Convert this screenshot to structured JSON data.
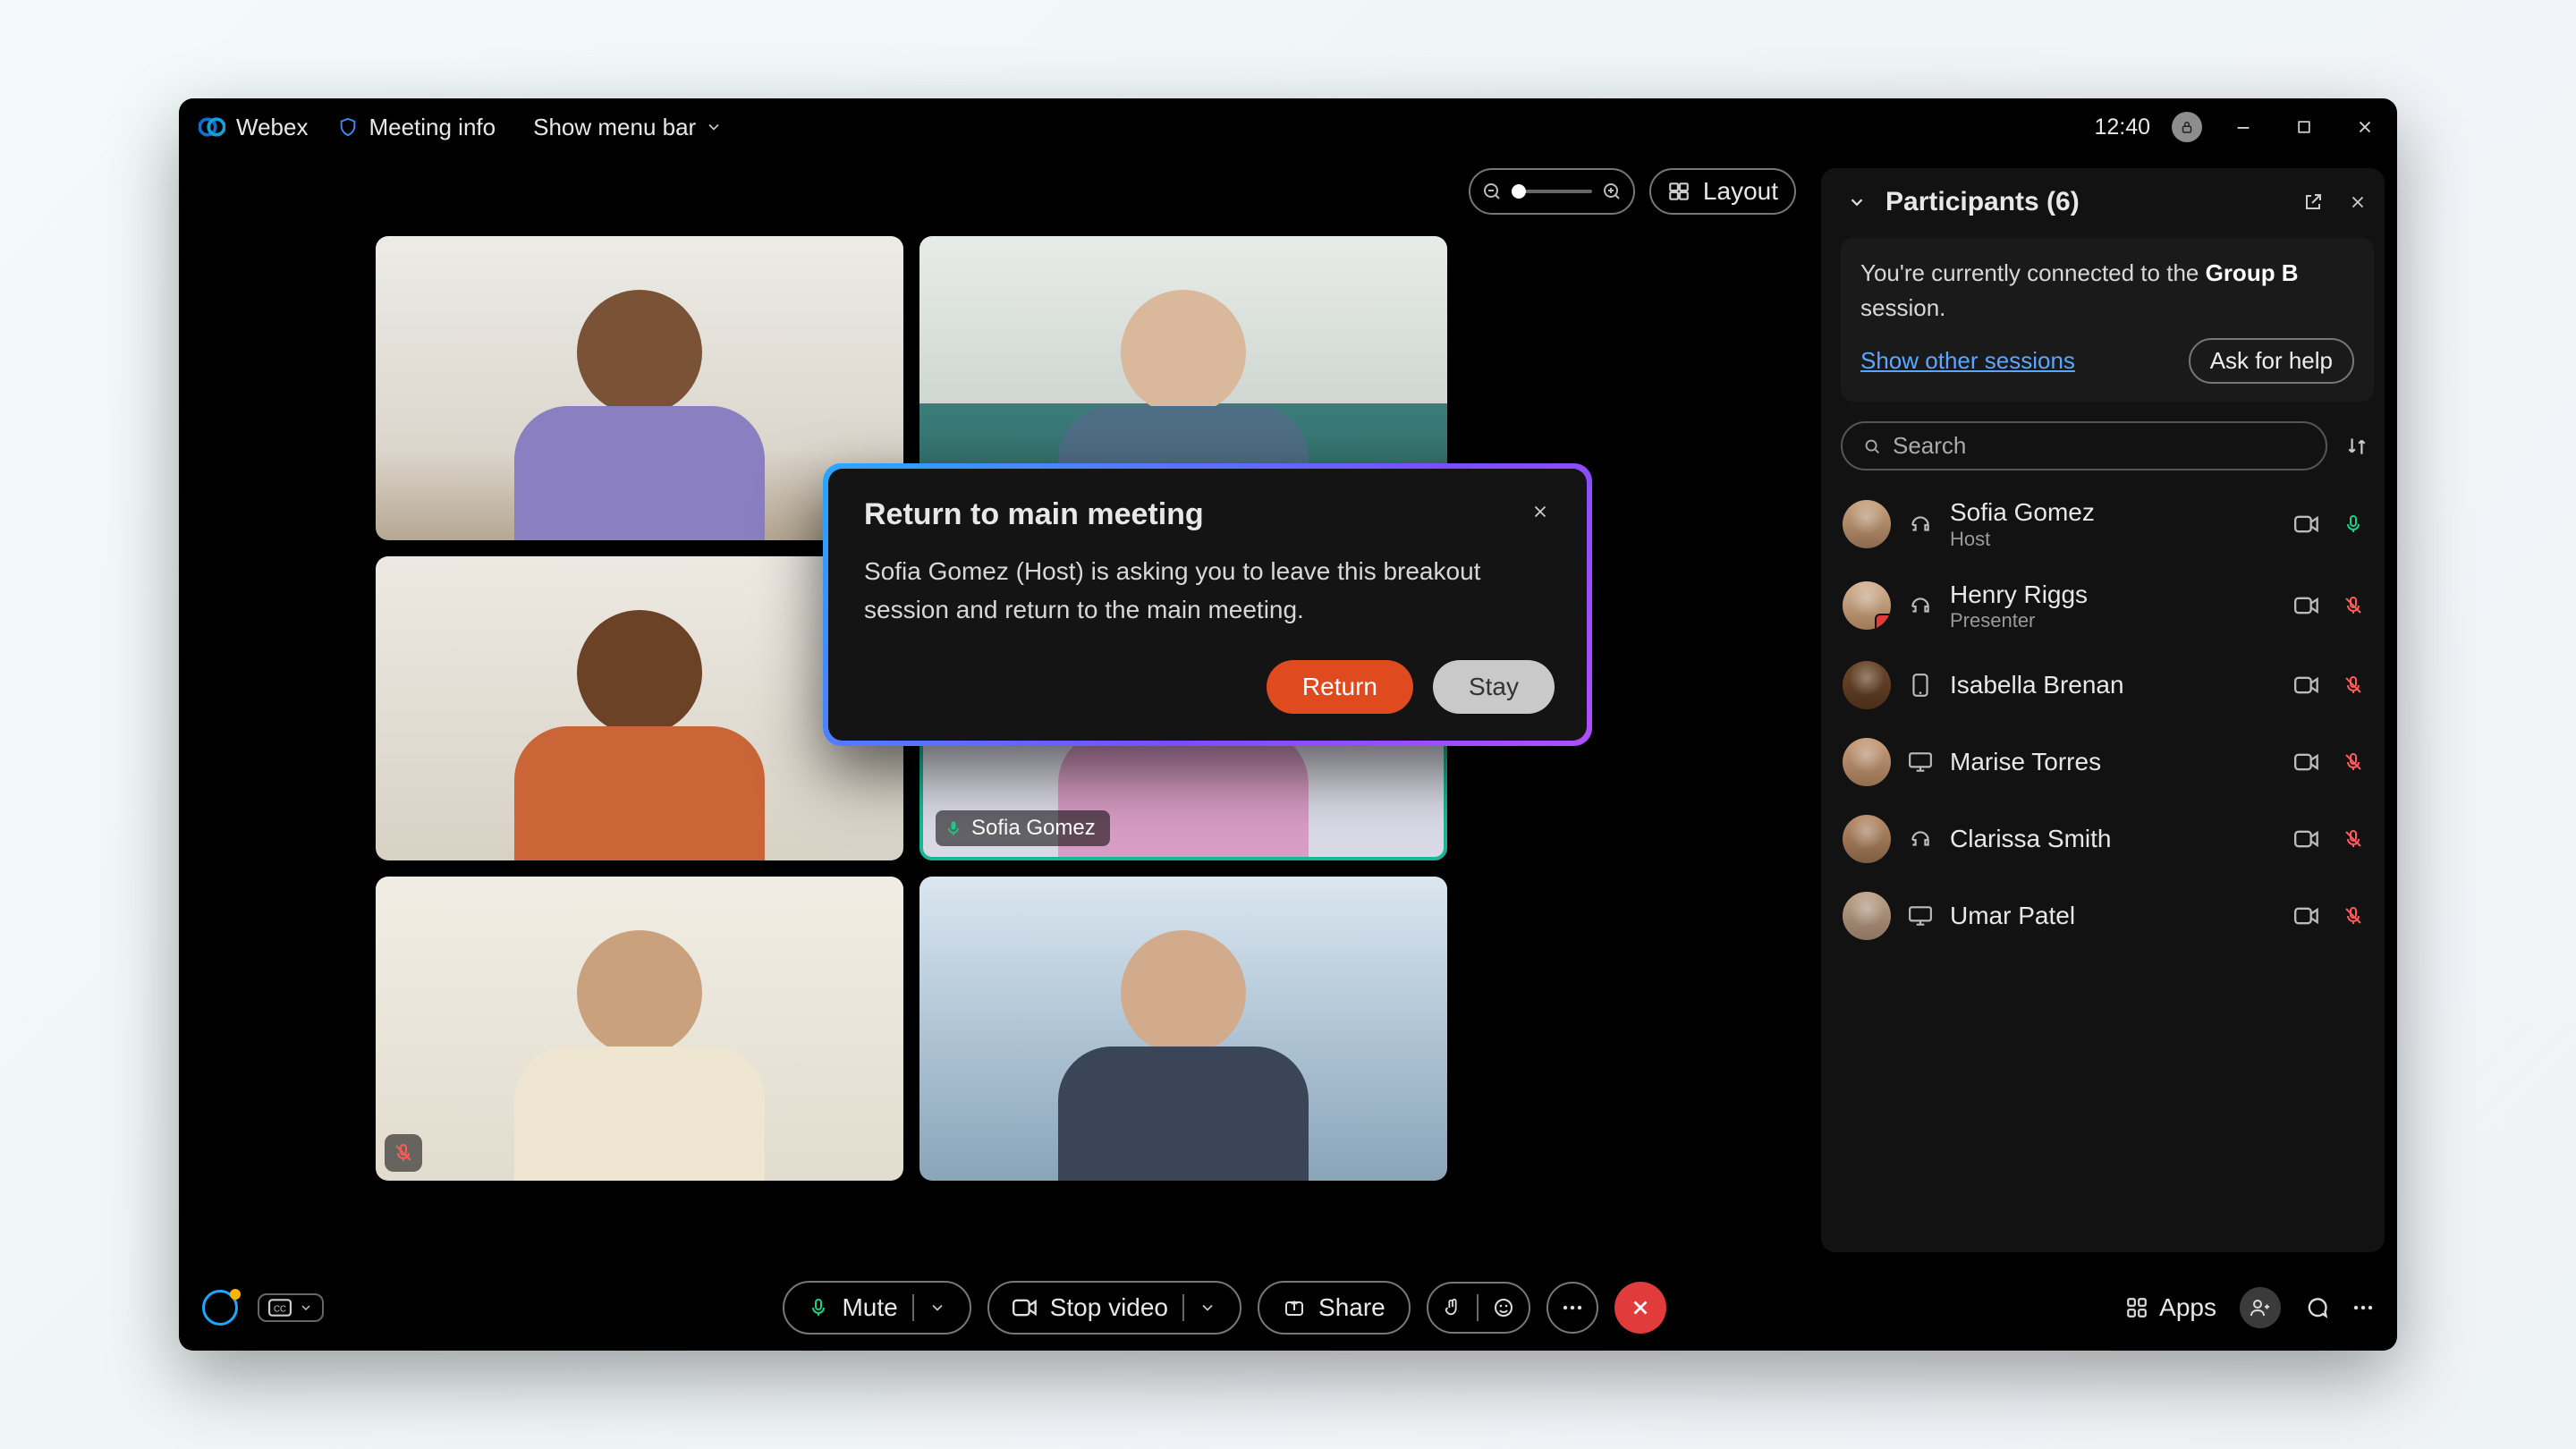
{
  "header": {
    "app_name": "Webex",
    "meeting_info_label": "Meeting info",
    "menu_toggle_label": "Show menu bar",
    "clock": "12:40"
  },
  "stage": {
    "layout_label": "Layout",
    "speaker_tile_name": "Sofia Gomez"
  },
  "participants_panel": {
    "title": "Participants (6)",
    "notice_prefix": "You're currently connected to the ",
    "notice_session": "Group B",
    "notice_suffix": " session.",
    "show_sessions_label": "Show other sessions",
    "ask_help_label": "Ask for help",
    "search_placeholder": "Search",
    "list": [
      {
        "name": "Sofia Gomez",
        "role": "Host",
        "device": "headset",
        "mic": "on"
      },
      {
        "name": "Henry Riggs",
        "role": "Presenter",
        "device": "headset",
        "mic": "off"
      },
      {
        "name": "Isabella Brenan",
        "role": "",
        "device": "mobile",
        "mic": "off"
      },
      {
        "name": "Marise Torres",
        "role": "",
        "device": "desktop",
        "mic": "off"
      },
      {
        "name": "Clarissa Smith",
        "role": "",
        "device": "headset",
        "mic": "off"
      },
      {
        "name": "Umar Patel",
        "role": "",
        "device": "desktop",
        "mic": "off"
      }
    ]
  },
  "controls": {
    "mute_label": "Mute",
    "stop_video_label": "Stop video",
    "share_label": "Share",
    "apps_label": "Apps"
  },
  "modal": {
    "title": "Return to main meeting",
    "body": "Sofia Gomez (Host) is asking you to leave this breakout session and return to the main meeting.",
    "primary": "Return",
    "secondary": "Stay"
  }
}
